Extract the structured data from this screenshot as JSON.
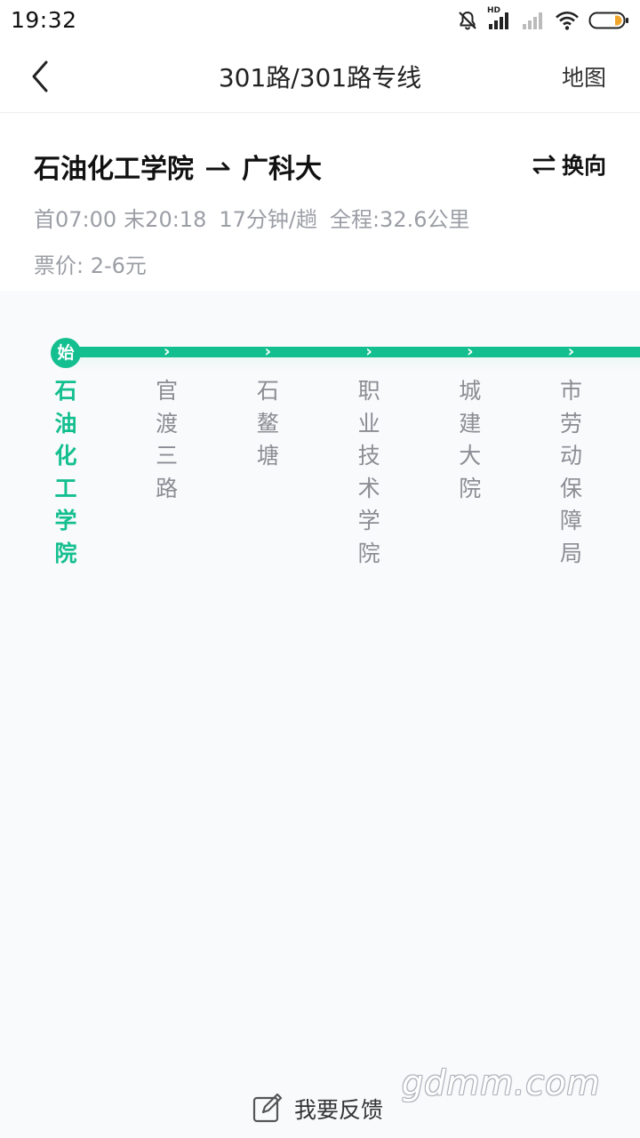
{
  "status_bar": {
    "time": "19:32",
    "signal_badge": "HD",
    "icons": [
      "mute-bell-icon",
      "signal-icon",
      "signal-weak-icon",
      "wifi-icon",
      "battery-icon"
    ]
  },
  "nav": {
    "back_icon": "chevron-left-icon",
    "title": "301路/301路专线",
    "map_label": "地图"
  },
  "route": {
    "from": "石油化工学院",
    "to": "广科大",
    "direction_icon": "arrow-right-icon",
    "reverse_label": "换向",
    "first_bus": "首07:00",
    "last_bus": "末20:18",
    "interval": "17分钟/趟",
    "distance": "全程:32.6公里",
    "fare": "票价: 2-6元"
  },
  "line": {
    "color": "#14bf8f",
    "start_badge": "始",
    "stops": [
      {
        "name": "石油化工学院",
        "current": true
      },
      {
        "name": "官渡三路",
        "current": false
      },
      {
        "name": "石鳌塘",
        "current": false
      },
      {
        "name": "职业技术学院",
        "current": false
      },
      {
        "name": "城建大院",
        "current": false
      },
      {
        "name": "市劳动保障局",
        "current": false
      }
    ]
  },
  "feedback": {
    "icon": "edit-icon",
    "label": "我要反馈"
  },
  "watermark": "gdmm.com"
}
